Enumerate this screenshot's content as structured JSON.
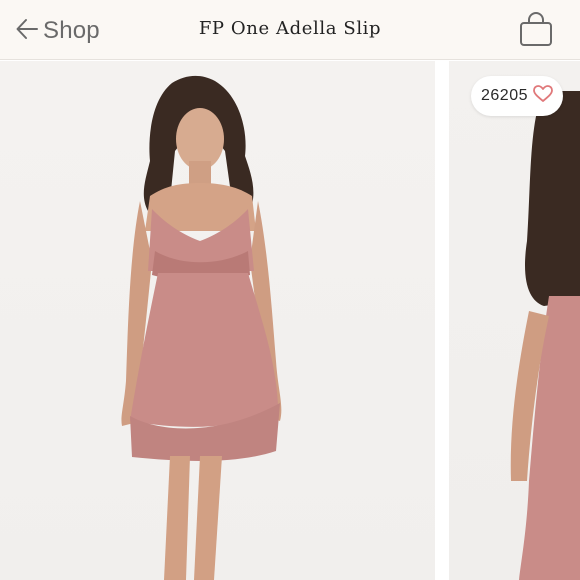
{
  "header": {
    "back_label": "Shop",
    "title": "FP One Adella Slip",
    "icons": {
      "back": "arrow-left-icon",
      "bag": "shopping-bag-icon"
    }
  },
  "gallery": {
    "images": [
      {
        "name": "product-photo-front"
      },
      {
        "name": "product-photo-side"
      }
    ]
  },
  "likes": {
    "count": "26205",
    "icon": "heart-icon",
    "heart_color": "#e0787a"
  },
  "colors": {
    "header_bg": "#fbf8f4",
    "dress": "#c98c88",
    "text_muted": "#6a6a6a"
  }
}
